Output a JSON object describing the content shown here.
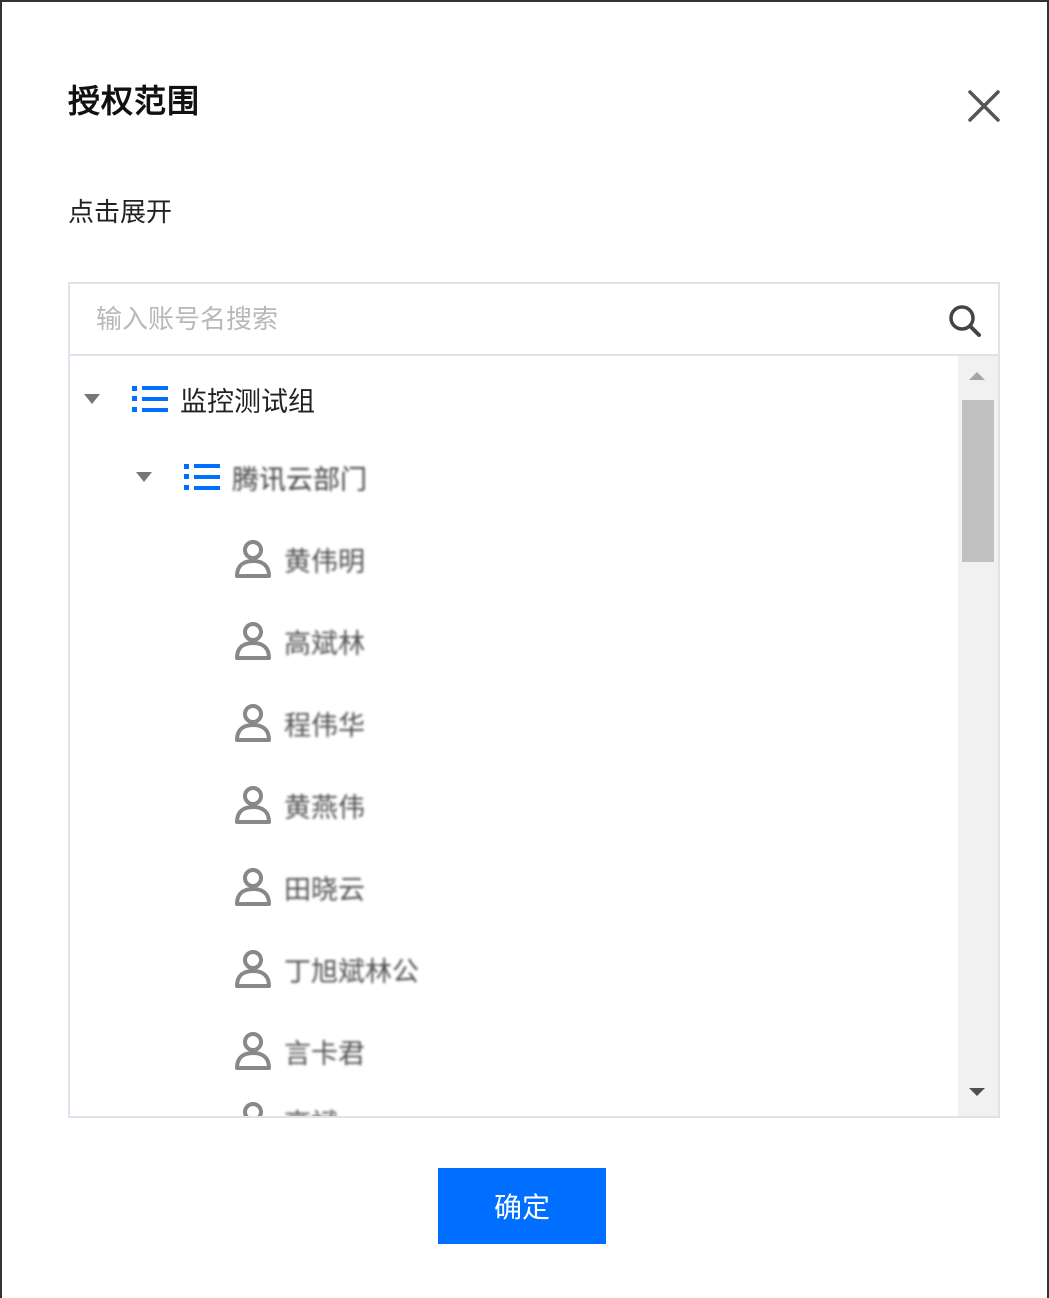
{
  "dialog": {
    "title": "授权范围",
    "hint": "点击展开",
    "confirm_label": "确定"
  },
  "search": {
    "placeholder": "输入账号名搜索",
    "value": ""
  },
  "tree": {
    "root": {
      "label": "监控测试组",
      "icon": "list-icon",
      "expanded": true
    },
    "group": {
      "label": "腾讯云部门",
      "icon": "list-icon",
      "expanded": true
    },
    "users": [
      {
        "label": "黄伟明",
        "icon": "user-icon"
      },
      {
        "label": "高斌林",
        "icon": "user-icon"
      },
      {
        "label": "程伟华",
        "icon": "user-icon"
      },
      {
        "label": "黄燕伟",
        "icon": "user-icon"
      },
      {
        "label": "田晓云",
        "icon": "user-icon"
      },
      {
        "label": "丁旭斌林公",
        "icon": "user-icon"
      },
      {
        "label": "言卡君",
        "icon": "user-icon"
      },
      {
        "label": "高斌",
        "icon": "user-icon"
      }
    ]
  },
  "colors": {
    "accent": "#006eff",
    "list_icon": "#006eff",
    "user_icon": "#888888",
    "border": "#dde3ea"
  }
}
